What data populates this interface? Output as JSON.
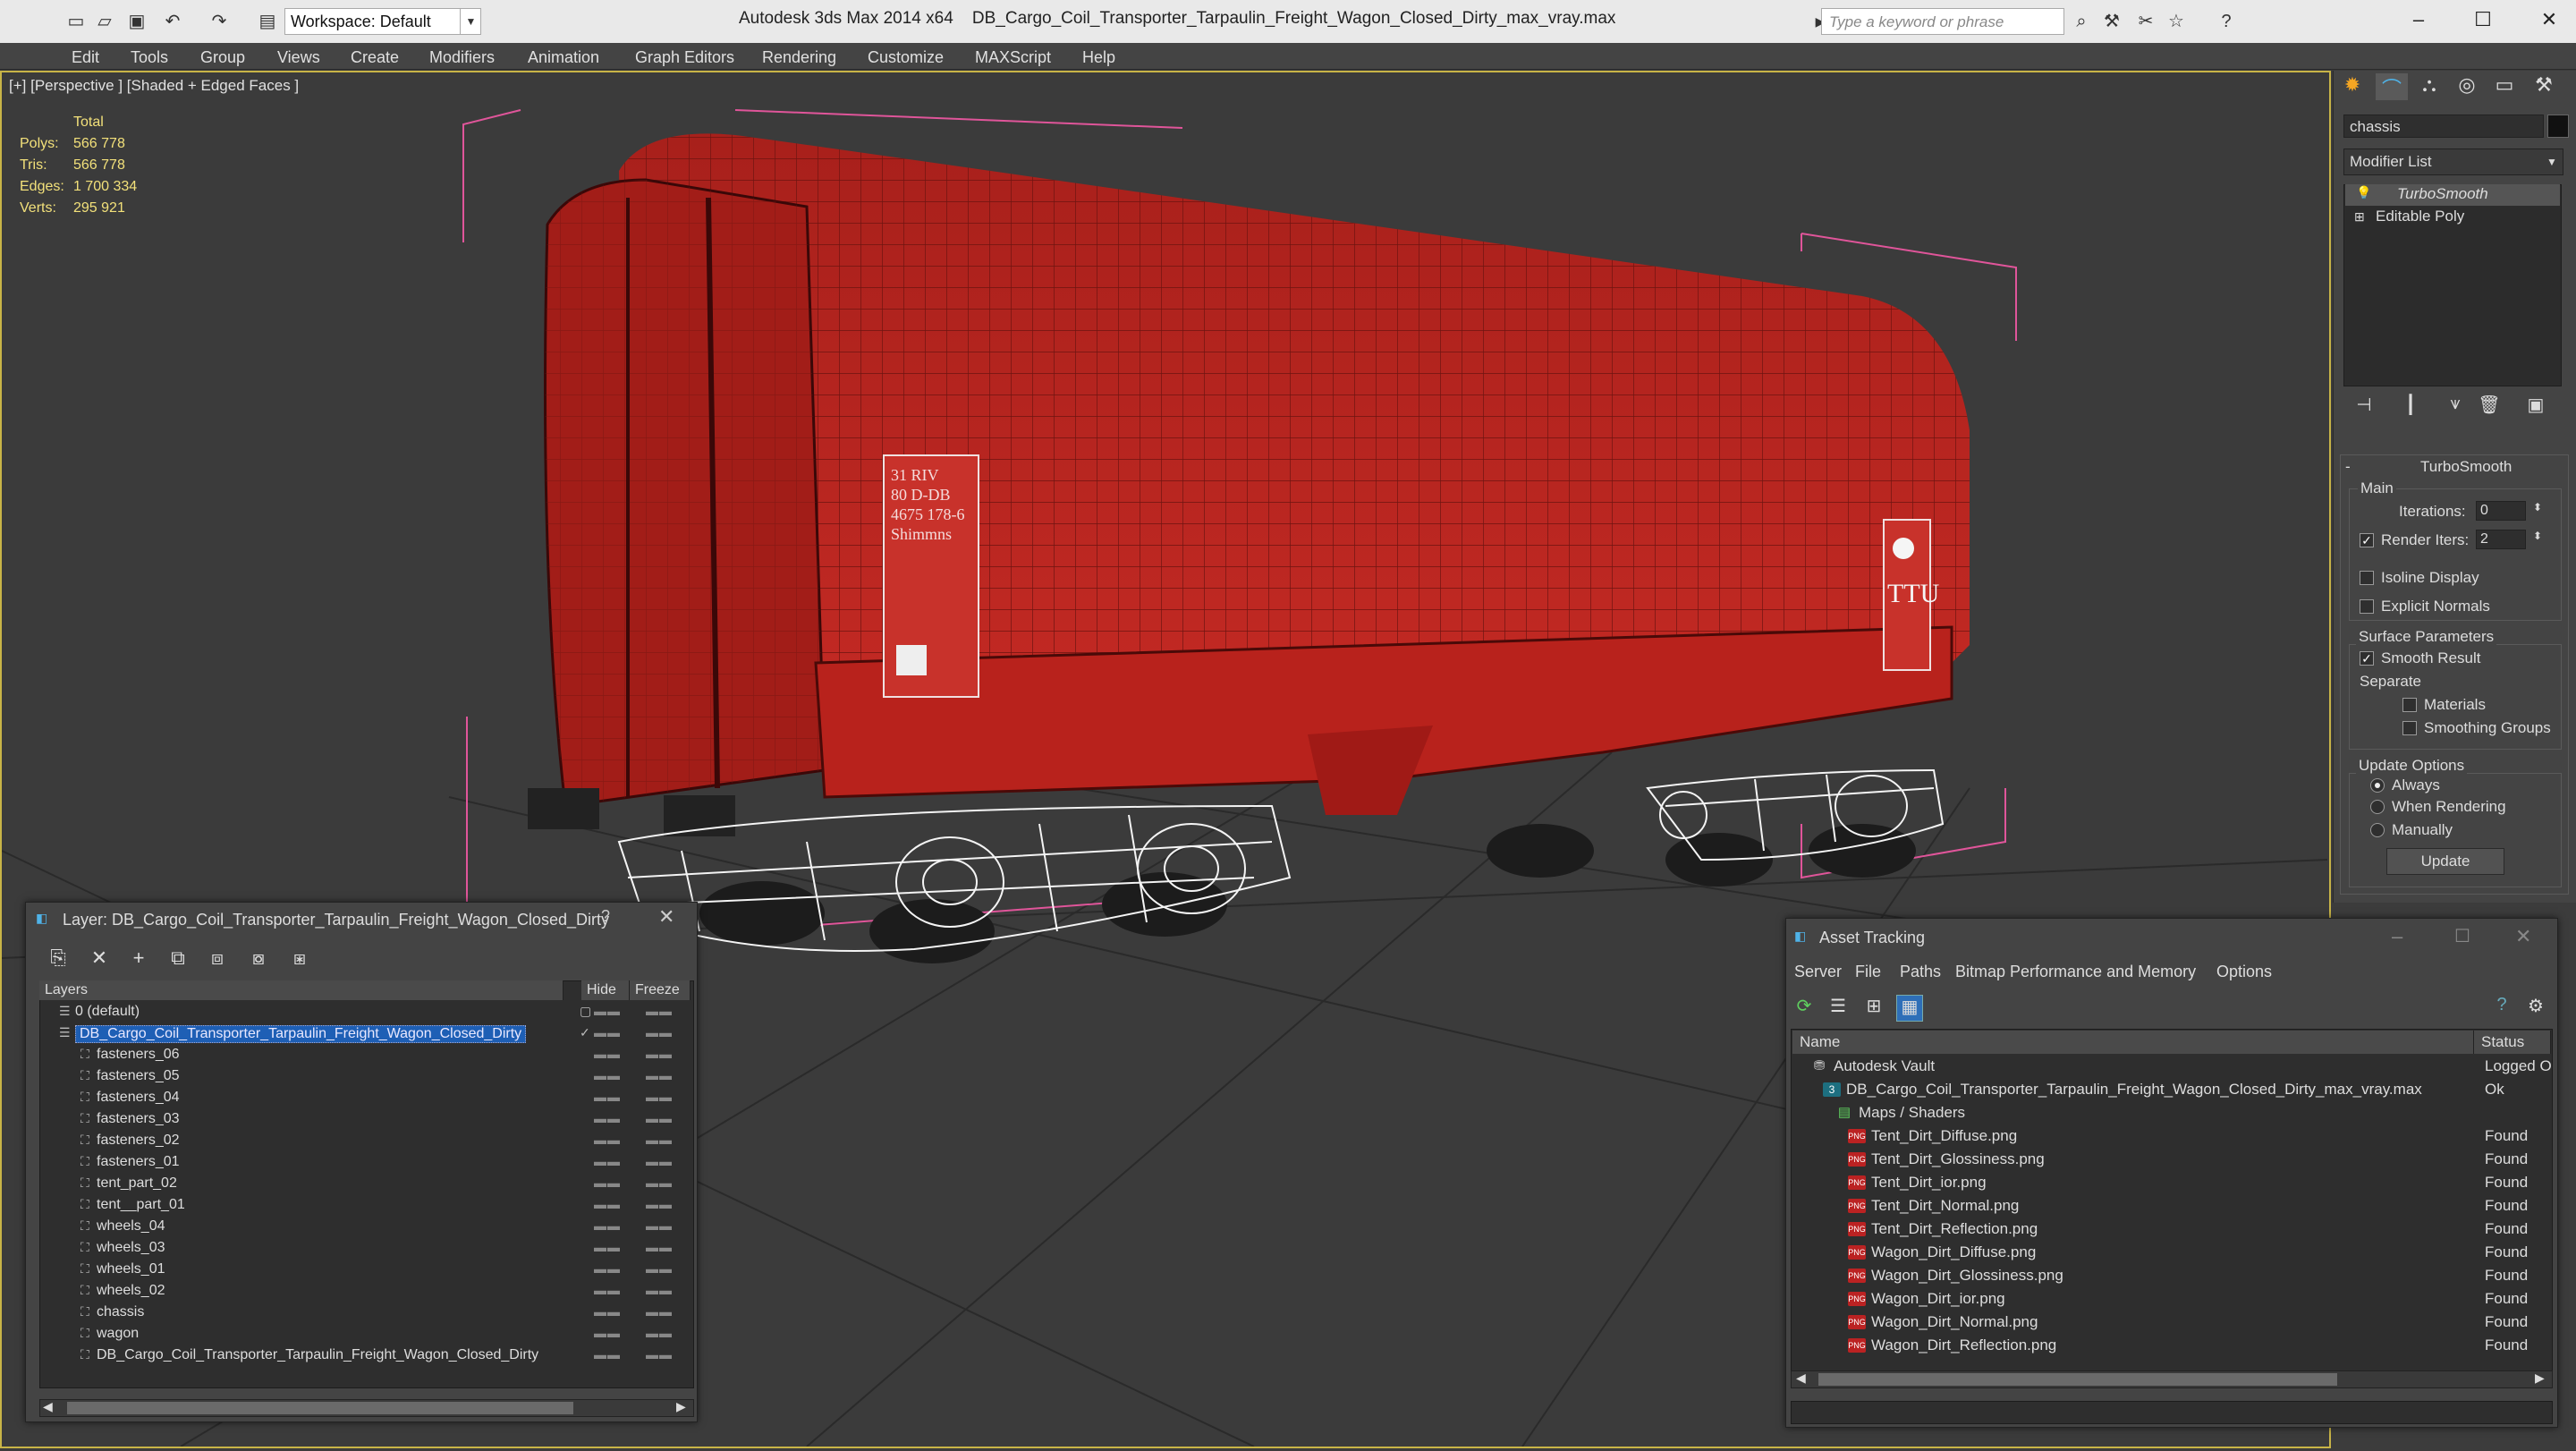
{
  "titlebar": {
    "app": "Autodesk 3ds Max  2014 x64",
    "file": "DB_Cargo_Coil_Transporter_Tarpaulin_Freight_Wagon_Closed_Dirty_max_vray.max",
    "workspace": "Workspace: Default",
    "search_placeholder": "Type a keyword or phrase"
  },
  "menu": [
    "Edit",
    "Tools",
    "Group",
    "Views",
    "Create",
    "Modifiers",
    "Animation",
    "Graph Editors",
    "Rendering",
    "Customize",
    "MAXScript",
    "Help"
  ],
  "viewport": {
    "label": "[+] [Perspective ] [Shaded + Edged Faces ]",
    "stats": {
      "header": "Total",
      "rows": [
        {
          "k": "Polys:",
          "v": "566 778"
        },
        {
          "k": "Tris:",
          "v": "566 778"
        },
        {
          "k": "Edges:",
          "v": "1 700 334"
        },
        {
          "k": "Verts:",
          "v": "295 921"
        }
      ]
    },
    "wagon_panel_left": [
      "31 RIV",
      "80 D-DB",
      "4675 178-6",
      "Shimmns"
    ],
    "wagon_logo_right": "TTU"
  },
  "command_panel": {
    "object_name": "chassis",
    "modifier_list": "Modifier List",
    "stack": [
      "TurboSmooth",
      "Editable Poly"
    ],
    "rollout_title": "TurboSmooth",
    "main_label": "Main",
    "iterations_label": "Iterations:",
    "iterations_value": "0",
    "render_iters_label": "Render Iters:",
    "render_iters_value": "2",
    "isoline_label": "Isoline Display",
    "explicit_normals_label": "Explicit Normals",
    "surface_params_label": "Surface Parameters",
    "smooth_result_label": "Smooth Result",
    "separate_label": "Separate",
    "materials_label": "Materials",
    "smoothing_groups_label": "Smoothing Groups",
    "update_options_label": "Update Options",
    "always_label": "Always",
    "when_rendering_label": "When Rendering",
    "manually_label": "Manually",
    "update_button": "Update"
  },
  "layer_dialog": {
    "title": "Layer: DB_Cargo_Coil_Transporter_Tarpaulin_Freight_Wagon_Closed_Dirty",
    "help": "?",
    "col_layers": "Layers",
    "col_hide": "Hide",
    "col_freeze": "Freeze",
    "rows": [
      {
        "name": "0 (default)",
        "level": 0
      },
      {
        "name": "DB_Cargo_Coil_Transporter_Tarpaulin_Freight_Wagon_Closed_Dirty",
        "level": 0
      },
      {
        "name": "fasteners_06",
        "level": 1
      },
      {
        "name": "fasteners_05",
        "level": 1
      },
      {
        "name": "fasteners_04",
        "level": 1
      },
      {
        "name": "fasteners_03",
        "level": 1
      },
      {
        "name": "fasteners_02",
        "level": 1
      },
      {
        "name": "fasteners_01",
        "level": 1
      },
      {
        "name": "tent_part_02",
        "level": 1
      },
      {
        "name": "tent__part_01",
        "level": 1
      },
      {
        "name": "wheels_04",
        "level": 1
      },
      {
        "name": "wheels_03",
        "level": 1
      },
      {
        "name": "wheels_01",
        "level": 1
      },
      {
        "name": "wheels_02",
        "level": 1
      },
      {
        "name": "chassis",
        "level": 1
      },
      {
        "name": "wagon",
        "level": 1
      },
      {
        "name": "DB_Cargo_Coil_Transporter_Tarpaulin_Freight_Wagon_Closed_Dirty",
        "level": 1
      }
    ]
  },
  "asset_dialog": {
    "title": "Asset Tracking",
    "menu": [
      "Server",
      "File",
      "Paths",
      "Bitmap Performance and Memory",
      "Options"
    ],
    "col_name": "Name",
    "col_status": "Status",
    "rows": [
      {
        "name": "Autodesk Vault",
        "status": "Logged O",
        "level": 0
      },
      {
        "name": "DB_Cargo_Coil_Transporter_Tarpaulin_Freight_Wagon_Closed_Dirty_max_vray.max",
        "status": "Ok",
        "level": 1
      },
      {
        "name": "Maps / Shaders",
        "status": "",
        "level": 2
      },
      {
        "name": "Tent_Dirt_Diffuse.png",
        "status": "Found",
        "level": 3
      },
      {
        "name": "Tent_Dirt_Glossiness.png",
        "status": "Found",
        "level": 3
      },
      {
        "name": "Tent_Dirt_ior.png",
        "status": "Found",
        "level": 3
      },
      {
        "name": "Tent_Dirt_Normal.png",
        "status": "Found",
        "level": 3
      },
      {
        "name": "Tent_Dirt_Reflection.png",
        "status": "Found",
        "level": 3
      },
      {
        "name": "Wagon_Dirt_Diffuse.png",
        "status": "Found",
        "level": 3
      },
      {
        "name": "Wagon_Dirt_Glossiness.png",
        "status": "Found",
        "level": 3
      },
      {
        "name": "Wagon_Dirt_ior.png",
        "status": "Found",
        "level": 3
      },
      {
        "name": "Wagon_Dirt_Normal.png",
        "status": "Found",
        "level": 3
      },
      {
        "name": "Wagon_Dirt_Reflection.png",
        "status": "Found",
        "level": 3
      }
    ]
  },
  "colors": {
    "accent_selected": "#1e5fb5",
    "viewport_border": "#c8b447",
    "stats_text": "#f2e07a",
    "wagon_red": "#b8201c"
  }
}
